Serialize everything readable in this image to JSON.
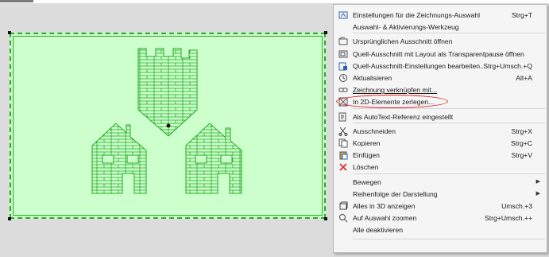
{
  "colors": {
    "frame_fill": "#ccffcc",
    "frame_line": "#27a827",
    "menu_bg": "#f5f5f5",
    "highlight": "#e02020"
  },
  "menu": {
    "items": [
      {
        "label": "Einstellungen für die Zeichnungs-Auswahl",
        "shortcut": "Strg+T",
        "icon": "drawing-settings-icon"
      },
      {
        "label": "Auswahl- & Aktivierungs-Werkzeug",
        "shortcut": "",
        "icon": ""
      },
      {
        "label": "Ursprünglichen Ausschnitt öffnen",
        "shortcut": "",
        "icon": "open-view-icon"
      },
      {
        "label": "Quell-Ausschnitt mit Layout als Transparentpause öffnen",
        "shortcut": "",
        "icon": "trace-icon"
      },
      {
        "label": "Quell-Ausschnitt-Einstellungen bearbeiten...",
        "shortcut": "Strg+Umsch.+Q",
        "icon": "view-settings-icon"
      },
      {
        "label": "Aktualisieren",
        "shortcut": "Alt+A",
        "icon": "refresh-icon"
      },
      {
        "label": "Zeichnung verknüpfen mit...",
        "shortcut": "",
        "icon": "link-icon"
      },
      {
        "label": "In 2D-Elemente zerlegen...",
        "shortcut": "",
        "icon": "explode-icon"
      },
      {
        "label": "Als AutoText-Referenz eingestellt",
        "shortcut": "",
        "icon": "autotext-icon"
      },
      {
        "label": "Ausschneiden",
        "shortcut": "Strg+X",
        "icon": "cut-icon"
      },
      {
        "label": "Kopieren",
        "shortcut": "Strg+C",
        "icon": "copy-icon"
      },
      {
        "label": "Einfügen",
        "shortcut": "Strg+V",
        "icon": "paste-icon"
      },
      {
        "label": "Löschen",
        "shortcut": "",
        "icon": "delete-icon"
      },
      {
        "label": "Bewegen",
        "shortcut": "",
        "icon": "",
        "submenu": "▶"
      },
      {
        "label": "Reihenfolge der Darstellung",
        "shortcut": "",
        "icon": "",
        "submenu": "▶"
      },
      {
        "label": "Alles in 3D anzeigen",
        "shortcut": "Umsch.+3",
        "icon": "show-3d-icon"
      },
      {
        "label": "Auf Auswahl zoomen",
        "shortcut": "Strg+Umsch.++",
        "icon": "zoom-icon"
      },
      {
        "label": "Alle deaktivieren",
        "shortcut": "",
        "icon": ""
      }
    ]
  }
}
